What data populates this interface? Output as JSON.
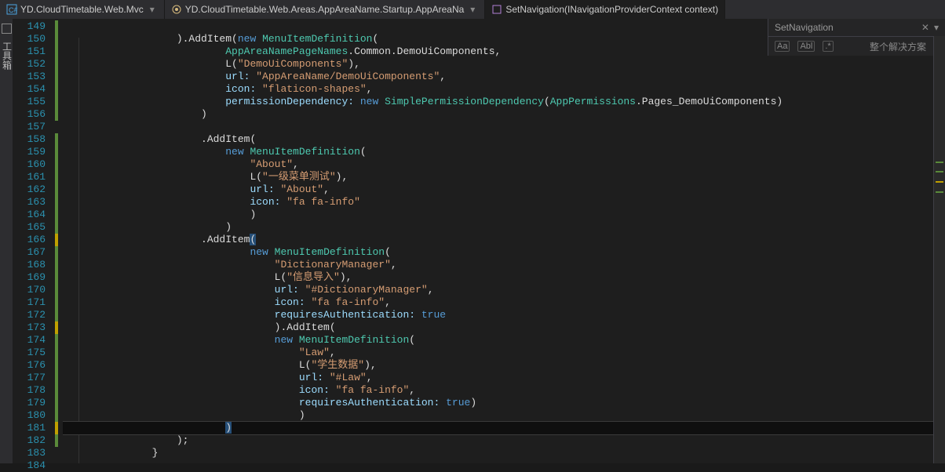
{
  "tabs": {
    "t1": "YD.CloudTimetable.Web.Mvc",
    "t2": "YD.CloudTimetable.Web.Areas.AppAreaName.Startup.AppAreaNa",
    "t3": "SetNavigation(INavigationProviderContext context)"
  },
  "sidebar_vertical": "工具箱",
  "side": {
    "title": "SetNavigation",
    "label": "整个解决方案"
  },
  "lines": {
    "start": 149,
    "end": 184
  },
  "code": {
    "l150a": ").AddItem(",
    "l150b": "new",
    "l150c": "MenuItemDefinition",
    "l150d": "(",
    "l151a": "AppAreaNamePageNames",
    "l151b": ".Common.DemoUiComponents,",
    "l152a": "L(",
    "l152b": "\"DemoUiComponents\"",
    "l152c": "),",
    "l153a": "url: ",
    "l153b": "\"AppAreaName/DemoUiComponents\"",
    "l153c": ",",
    "l154a": "icon: ",
    "l154b": "\"flaticon-shapes\"",
    "l154c": ",",
    "l155a": "permissionDependency: ",
    "l155b": "new",
    "l155c": "SimplePermissionDependency",
    "l155d": "(",
    "l155e": "AppPermissions",
    "l155f": ".Pages_DemoUiComponents)",
    "l156": ")",
    "l158": ".AddItem(",
    "l159a": "new",
    "l159b": "MenuItemDefinition",
    "l159c": "(",
    "l160": "\"About\"",
    "l160b": ",",
    "l161a": "L(",
    "l161b": "\"一级菜单测试\"",
    "l161c": "),",
    "l162a": "url: ",
    "l162b": "\"About\"",
    "l162c": ",",
    "l163a": "icon: ",
    "l163b": "\"fa fa-info\"",
    "l164": ")",
    "l165": ")",
    "l166": ".AddItem",
    "l166b": "(",
    "l167a": "new",
    "l167b": "MenuItemDefinition",
    "l167c": "(",
    "l168": "\"DictionaryManager\"",
    "l168b": ",",
    "l169a": "L(",
    "l169b": "\"信息导入\"",
    "l169c": "),",
    "l170a": "url: ",
    "l170b": "\"#DictionaryManager\"",
    "l170c": ",",
    "l171a": "icon: ",
    "l171b": "\"fa fa-info\"",
    "l171c": ",",
    "l172a": "requiresAuthentication: ",
    "l172b": "true",
    "l173": ").AddItem(",
    "l174a": "new",
    "l174b": "MenuItemDefinition",
    "l174c": "(",
    "l175": "\"Law\"",
    "l175b": ",",
    "l176a": "L(",
    "l176b": "\"学生数据\"",
    "l176c": "),",
    "l177a": "url: ",
    "l177b": "\"#Law\"",
    "l177c": ",",
    "l178a": "icon: ",
    "l178b": "\"fa fa-info\"",
    "l178c": ",",
    "l179a": "requiresAuthentication: ",
    "l179b": "true",
    "l179c": ")",
    "l180": ")",
    "l181": ")",
    "l182": ");",
    "l183": "}"
  }
}
